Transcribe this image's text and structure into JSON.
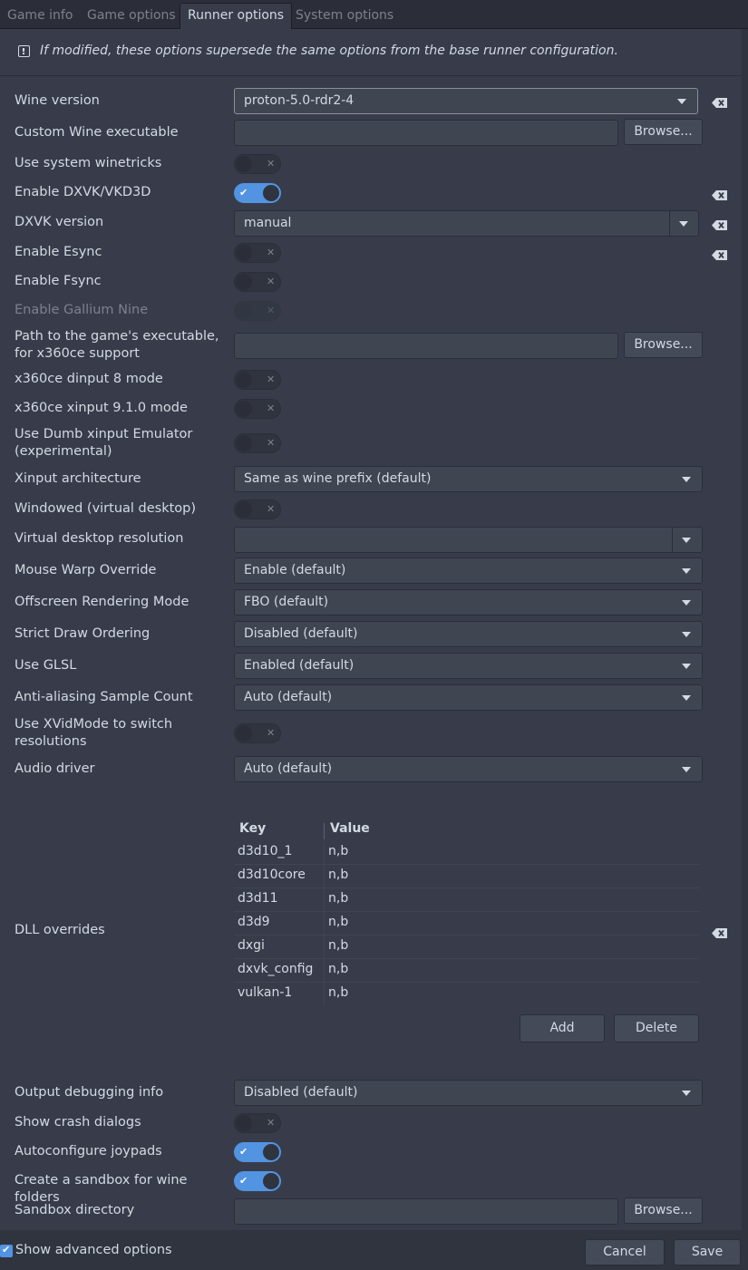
{
  "tabs": [
    {
      "label": "Game info"
    },
    {
      "label": "Game options"
    },
    {
      "label": "Runner options"
    },
    {
      "label": "System options"
    }
  ],
  "active_tab": "Runner options",
  "info_message": "If modified, these options supersede the same options from the base runner configuration.",
  "fields": {
    "wine_version": {
      "label": "Wine version",
      "value": "proton-5.0-rdr2-4"
    },
    "custom_wine_exe": {
      "label": "Custom Wine executable",
      "value": "",
      "button": "Browse..."
    },
    "system_winetricks": {
      "label": "Use system winetricks",
      "checked": false
    },
    "dxvk": {
      "label": "Enable DXVK/VKD3D",
      "checked": true
    },
    "dxvk_version": {
      "label": "DXVK version",
      "value": "manual"
    },
    "esync": {
      "label": "Enable Esync",
      "checked": false
    },
    "fsync": {
      "label": "Enable Fsync",
      "checked": false
    },
    "gallium_nine": {
      "label": "Enable Gallium Nine",
      "checked": false,
      "disabled": true
    },
    "x360ce_path": {
      "label": "Path to the game's executable, for x360ce support",
      "value": "",
      "button": "Browse..."
    },
    "x360ce_dinput": {
      "label": "x360ce dinput 8 mode",
      "checked": false
    },
    "x360ce_xinput": {
      "label": "x360ce xinput 9.1.0 mode",
      "checked": false
    },
    "dumb_xinput": {
      "label": "Use Dumb xinput Emulator (experimental)",
      "checked": false
    },
    "xinput_arch": {
      "label": "Xinput architecture",
      "value": "Same as wine prefix (default)"
    },
    "windowed": {
      "label": "Windowed (virtual desktop)",
      "checked": false
    },
    "desktop_res": {
      "label": "Virtual desktop resolution",
      "value": ""
    },
    "mouse_warp": {
      "label": "Mouse Warp Override",
      "value": "Enable (default)"
    },
    "offscreen": {
      "label": "Offscreen Rendering Mode",
      "value": "FBO (default)"
    },
    "strict_draw": {
      "label": "Strict Draw Ordering",
      "value": "Disabled (default)"
    },
    "glsl": {
      "label": "Use GLSL",
      "value": "Enabled (default)"
    },
    "msaa": {
      "label": "Anti-aliasing Sample Count",
      "value": "Auto (default)"
    },
    "xvidmode": {
      "label": "Use XVidMode to switch resolutions",
      "checked": false
    },
    "audio": {
      "label": "Audio driver",
      "value": "Auto (default)"
    },
    "dll_overrides": {
      "label": "DLL overrides",
      "columns": [
        "Key",
        "Value"
      ],
      "rows": [
        [
          "d3d10_1",
          "n,b"
        ],
        [
          "d3d10core",
          "n,b"
        ],
        [
          "d3d11",
          "n,b"
        ],
        [
          "d3d9",
          "n,b"
        ],
        [
          "dxgi",
          "n,b"
        ],
        [
          "dxvk_config",
          "n,b"
        ],
        [
          "vulkan-1",
          "n,b"
        ]
      ],
      "add_label": "Add",
      "delete_label": "Delete"
    },
    "debug_output": {
      "label": "Output debugging info",
      "value": "Disabled (default)"
    },
    "crash_dialogs": {
      "label": "Show crash dialogs",
      "checked": false
    },
    "joypads": {
      "label": "Autoconfigure joypads",
      "checked": true
    },
    "sandbox": {
      "label": "Create a sandbox for wine folders",
      "checked": true
    },
    "sandbox_dir": {
      "label": "Sandbox directory",
      "value": "",
      "button": "Browse..."
    }
  },
  "footer": {
    "advanced_label": "Show advanced options",
    "advanced_checked": true,
    "cancel_label": "Cancel",
    "save_label": "Save"
  },
  "colors": {
    "accent": "#5294e2",
    "background": "#383c4a",
    "text": "#d3dae3"
  }
}
